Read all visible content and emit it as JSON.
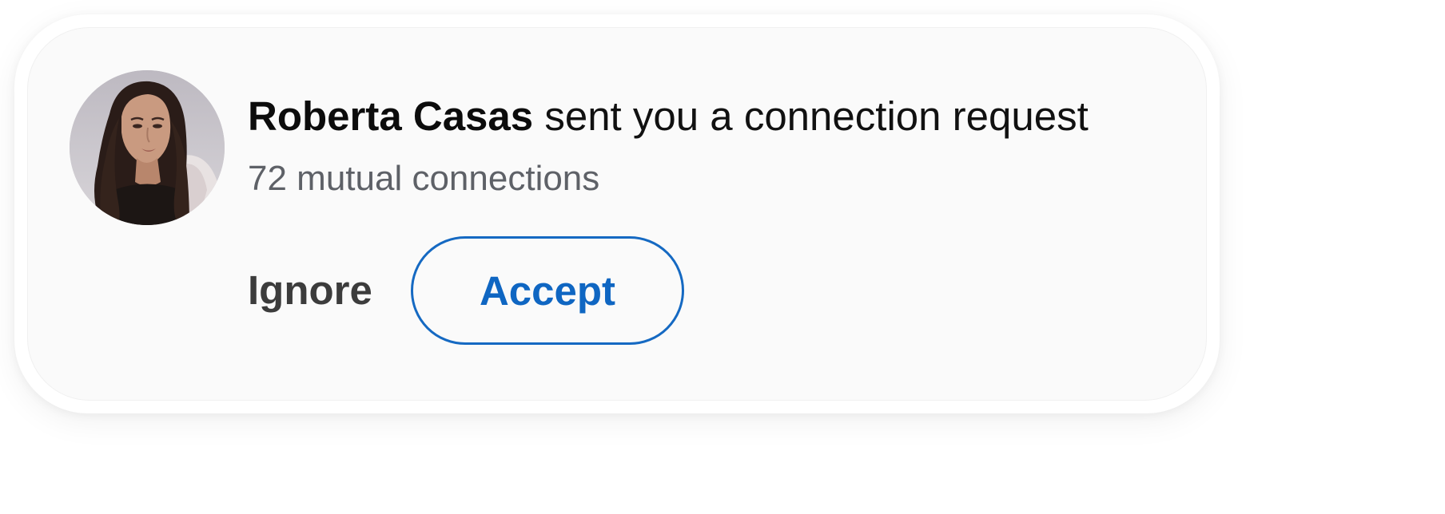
{
  "notification": {
    "sender_name": "Roberta Casas",
    "message": " sent you a connection request",
    "mutual_connections": "72 mutual connections",
    "avatar_icon": "user-avatar-photo"
  },
  "actions": {
    "ignore_label": "Ignore",
    "accept_label": "Accept"
  },
  "colors": {
    "accent": "#0f66c2",
    "card_background": "#fafafa",
    "secondary_text": "#5e6167"
  }
}
